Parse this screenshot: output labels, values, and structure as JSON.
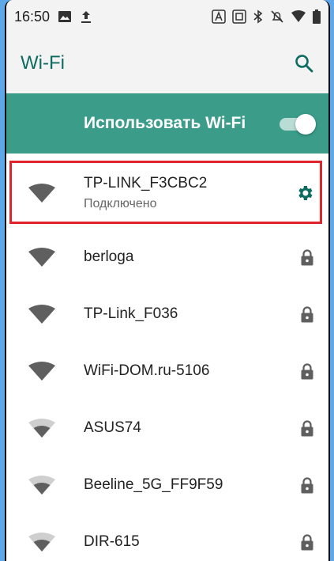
{
  "status_bar": {
    "time": "16:50"
  },
  "app_bar": {
    "title": "Wi-Fi"
  },
  "wifi_toggle": {
    "label": "Использовать Wi-Fi",
    "state": "on"
  },
  "networks": [
    {
      "name": "TP-LINK_F3CBC2",
      "status": "Подключено",
      "signal": "full",
      "action": "gear-icon"
    },
    {
      "name": "berloga",
      "signal": "full",
      "action": "lock-icon"
    },
    {
      "name": "TP-Link_F036",
      "signal": "full",
      "action": "lock-icon"
    },
    {
      "name": "WiFi-DOM.ru-5106",
      "signal": "full",
      "action": "lock-icon"
    },
    {
      "name": "ASUS74",
      "signal": "partial",
      "action": "lock-icon"
    },
    {
      "name": "Beeline_5G_FF9F59",
      "signal": "partial",
      "action": "lock-icon"
    },
    {
      "name": "DIR-615",
      "signal": "partial",
      "action": "lock-icon"
    }
  ],
  "colors": {
    "accent": "#0d6b5f",
    "toggle_bar": "#3a9c89",
    "highlight": "#e0242b",
    "icon_grey": "#5f5f5f"
  }
}
